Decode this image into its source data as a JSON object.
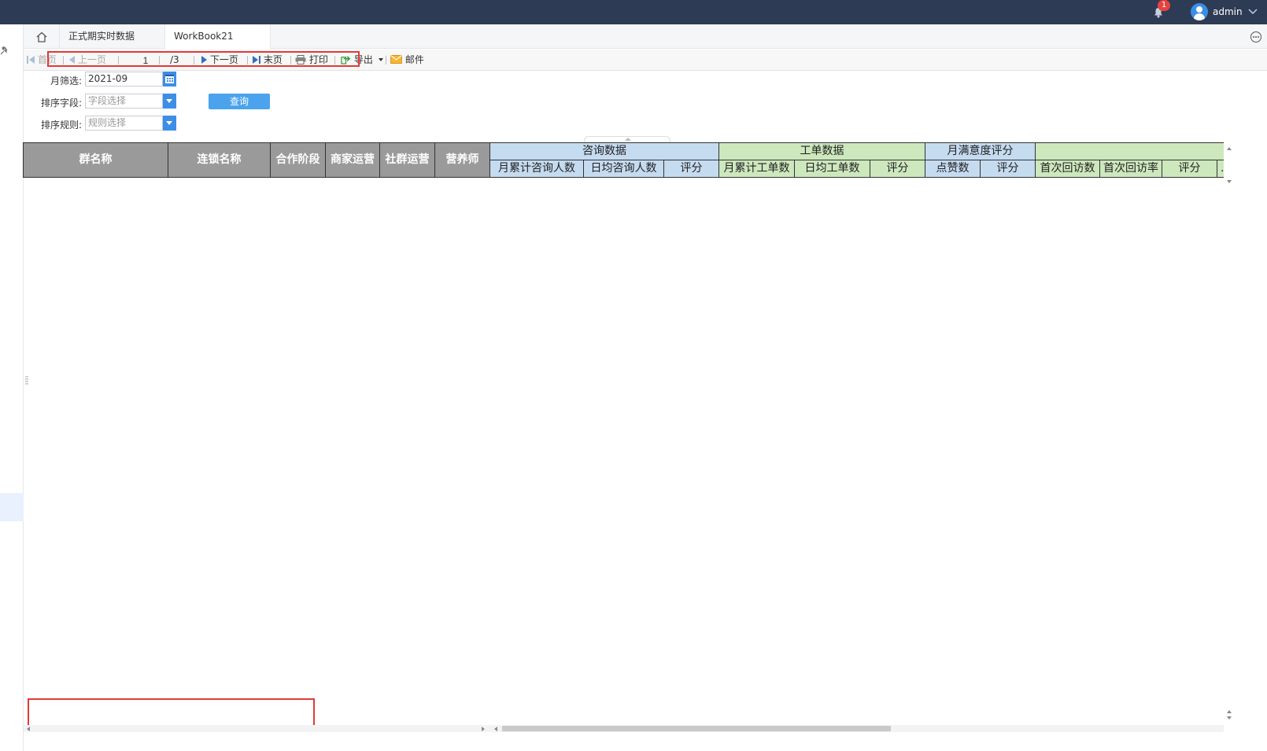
{
  "header": {
    "notification_count": "1",
    "username": "admin"
  },
  "tabs": [
    {
      "label": "正式期实时数据"
    },
    {
      "label": "WorkBook21"
    }
  ],
  "toolbar": {
    "first": "首页",
    "prev": "上一页",
    "page_current": "1",
    "page_total": "/3",
    "next": "下一页",
    "last": "末页",
    "print": "打印",
    "export": "导出",
    "email": "邮件"
  },
  "filters": {
    "month_label": "月筛选:",
    "month_value": "2021-09",
    "sort_field_label": "排序字段:",
    "sort_field_placeholder": "字段选择",
    "sort_rule_label": "排序规则:",
    "sort_rule_placeholder": "规则选择",
    "query_button": "查询"
  },
  "table": {
    "fixed_headers": [
      "群名称",
      "连锁名称",
      "合作阶段",
      "商家运营",
      "社群运营",
      "营养师"
    ],
    "groups": [
      {
        "label": "咨询数据",
        "color": "#c5dbf0",
        "sub": [
          "月累计咨询人数",
          "日均咨询人数",
          "评分"
        ]
      },
      {
        "label": "工单数据",
        "color": "#cde8bd",
        "sub": [
          "月累计工单数",
          "日均工单数",
          "评分"
        ]
      },
      {
        "label": "月满意度评分",
        "color": "#c5dbf0",
        "sub": [
          "点赞数",
          "评分"
        ]
      },
      {
        "label": "",
        "color": "#cde8bd",
        "sub": [
          "首次回访数",
          "首次回访率",
          "评分",
          "..."
        ]
      }
    ]
  },
  "icons": {
    "bell": "bell-icon",
    "home": "home-icon",
    "calendar": "calendar-icon",
    "print": "printer-icon",
    "export": "export-icon",
    "email": "envelope-icon"
  },
  "colors": {
    "topbar": "#2e3b55",
    "accent": "#3c8ee6",
    "badge": "#e64340",
    "highlight": "#e53935"
  }
}
